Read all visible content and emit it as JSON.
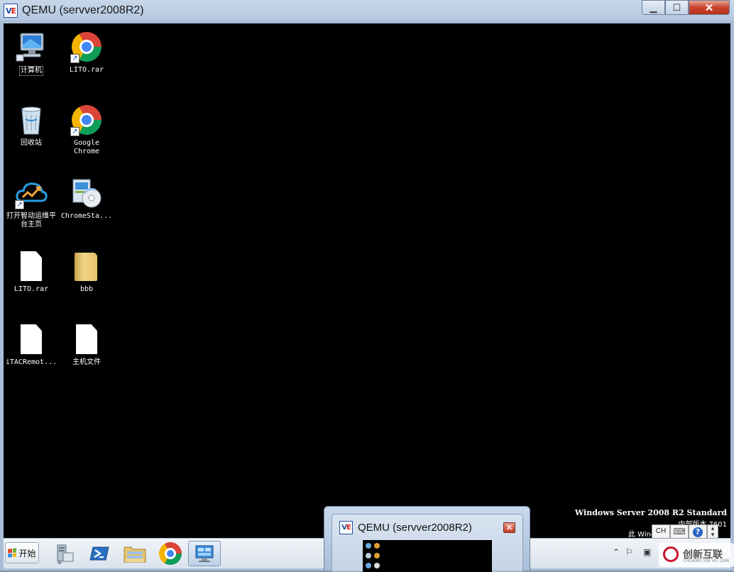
{
  "window": {
    "title": "QEMU (servver2008R2)",
    "icon_text": "VE",
    "minimize_symbol": "▁",
    "maximize_symbol": "☐",
    "close_symbol": "✕"
  },
  "desktop": {
    "icons": [
      {
        "label": "计算机",
        "icon": "computer-icon"
      },
      {
        "label": "LITO.rar",
        "icon": "chrome-shortcut-icon"
      },
      {
        "label": "回收站",
        "icon": "recycle-bin-icon"
      },
      {
        "label": "Google Chrome",
        "icon": "chrome-shortcut-icon"
      },
      {
        "label": "打开智动运维平台主页",
        "icon": "cloud-shortcut-icon"
      },
      {
        "label": "ChromeSta...",
        "icon": "installer-icon"
      },
      {
        "label": "LITO.rar",
        "icon": "file-icon"
      },
      {
        "label": "bbb",
        "icon": "folder-icon"
      },
      {
        "label": "iTACRemot...",
        "icon": "file-icon"
      },
      {
        "label": "主机文件",
        "icon": "file-icon"
      }
    ],
    "watermark": {
      "edition": "Windows Server 2008 R2 Standard",
      "line2": "内部版本 7601",
      "line3": "此 Wind"
    }
  },
  "taskbar": {
    "start_label": "开始",
    "pinned": [
      "server-manager-icon",
      "powershell-icon",
      "explorer-icon",
      "chrome-icon",
      "control-panel-icon"
    ],
    "ime": {
      "lang": "CH",
      "help": "?"
    }
  },
  "preview": {
    "title": "QEMU (servver2008R2)",
    "icon_text": "VE",
    "close_symbol": "✕"
  },
  "logo": {
    "name": "创新互联",
    "sub": "CHUANG XIN HU LIAN"
  },
  "colors": {
    "screen_bg": "#000000",
    "accent": "#1f4fa0",
    "close_red": "#c9442c"
  }
}
